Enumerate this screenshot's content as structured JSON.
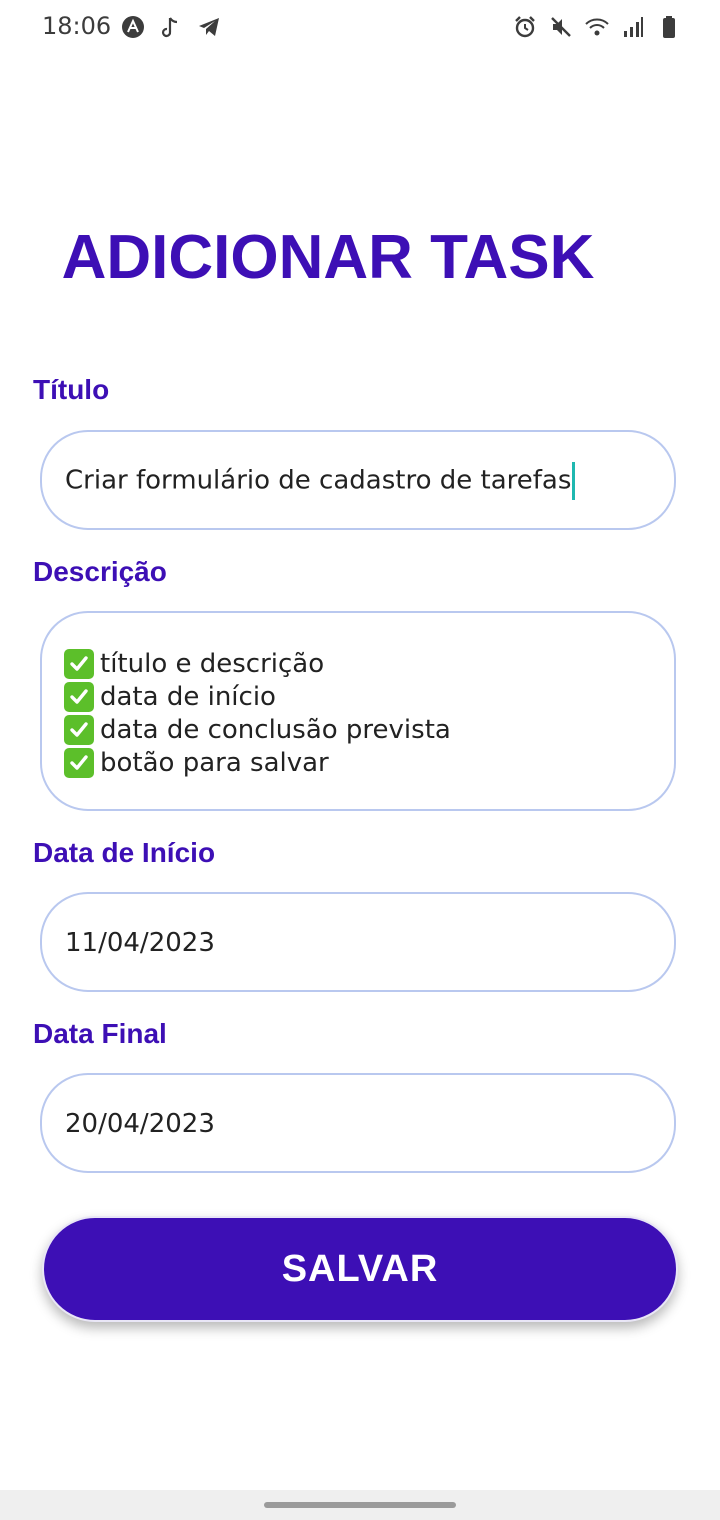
{
  "status_bar": {
    "time": "18:06",
    "left_icons": [
      "app-a-icon",
      "music-note-icon",
      "telegram-icon"
    ],
    "right_icons": [
      "alarm-icon",
      "mute-icon",
      "wifi-icon",
      "signal-icon",
      "battery-icon"
    ]
  },
  "header": {
    "title": "ADICIONAR TASK"
  },
  "form": {
    "titulo": {
      "label": "Título",
      "value": "Criar formulário de cadastro de tarefas"
    },
    "descricao": {
      "label": "Descrição",
      "items": [
        "título e descrição",
        "data de início",
        "data de conclusão prevista",
        "botão para salvar"
      ]
    },
    "data_inicio": {
      "label": "Data de Início",
      "value": "11/04/2023"
    },
    "data_final": {
      "label": "Data Final",
      "value": "20/04/2023"
    }
  },
  "actions": {
    "save_label": "SALVAR"
  },
  "colors": {
    "accent": "#3d0fb5",
    "field_border": "#b9c8ef",
    "check": "#5cbf2a",
    "caret": "#1fb8b0"
  }
}
